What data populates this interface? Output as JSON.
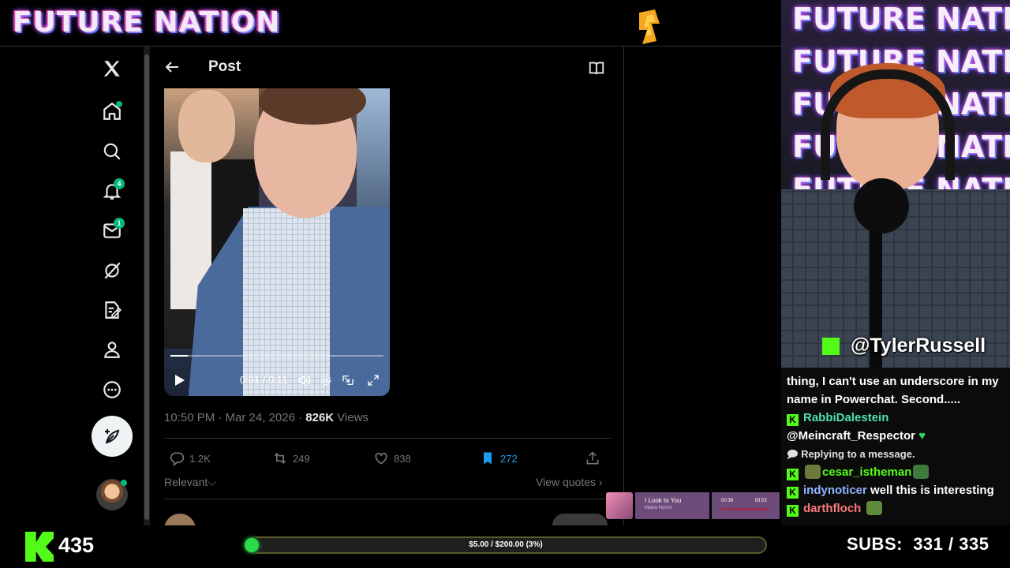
{
  "overlay": {
    "banner_title": "FUTURE NATION",
    "cam_texts": [
      "FUTURE NATION",
      "FUTURE NATION",
      "FUTURE NATION",
      "FUTURE NATION",
      "FUTURE NATION"
    ],
    "streamer_handle": "@TylerRussell",
    "viewer_count": "435",
    "goal_text": "$5.00 / $200.00 (3%)",
    "goal_fraction": 0.03,
    "subs_label": "SUBS:",
    "subs_value": "331 / 335",
    "accent": "#53fc18"
  },
  "nav": {
    "notifications_badge": "4",
    "messages_badge": "1"
  },
  "post": {
    "header_title": "Post",
    "video": {
      "time": "0:01 / 0:11",
      "progress_fraction": 0.08
    },
    "timestamp": "10:50 PM · Mar 24, 2026 · ",
    "views_count": "826K",
    "views_label": "Views",
    "replies": "1.2K",
    "reposts": "249",
    "likes": "838",
    "bookmarks": "272",
    "sort_label": "Relevant",
    "view_quotes": "View quotes"
  },
  "chat": {
    "messages": [
      {
        "text": "thing, I can't use an underscore in my name in Powerchat. Second....."
      },
      {
        "user": "RabbiDalestein"
      },
      {
        "text": "@Meincraft_Respector"
      },
      {
        "note": "Replying to a message."
      },
      {
        "user": "cesar_istheman"
      },
      {
        "user": "indynoticer",
        "text": "well this is interesting"
      },
      {
        "user": "darthfloch"
      }
    ]
  },
  "music": {
    "title": "I Look to You",
    "artist": "Miami Horror",
    "elapsed": "00:39",
    "duration": "03:53"
  }
}
